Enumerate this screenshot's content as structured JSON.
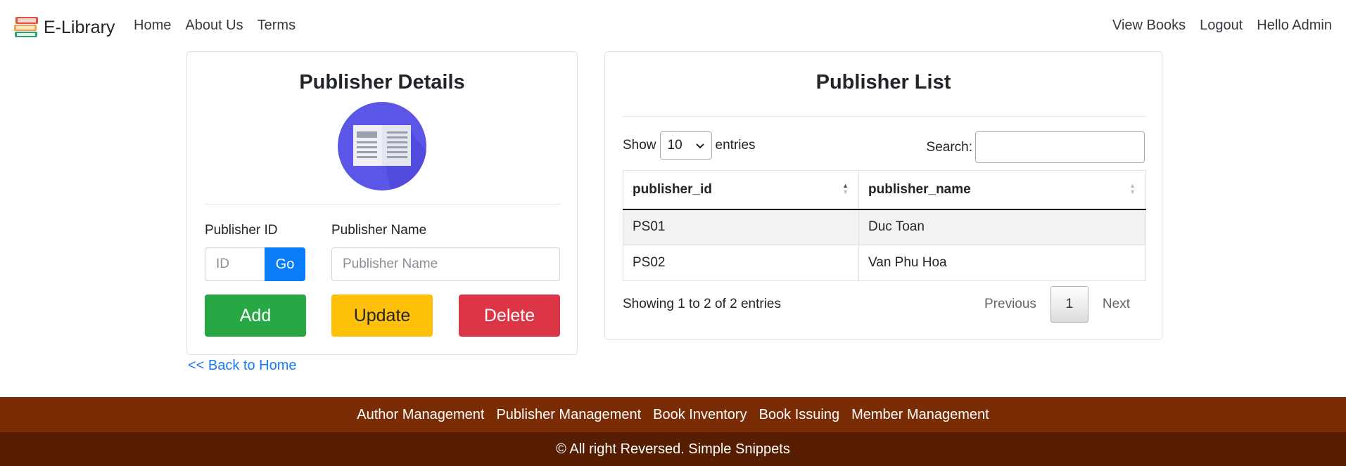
{
  "navbar": {
    "brand": "E-Library",
    "left_links": [
      "Home",
      "About Us",
      "Terms"
    ],
    "right_links": [
      "View Books",
      "Logout",
      "Hello Admin"
    ]
  },
  "details_card": {
    "title": "Publisher Details",
    "publisher_id_label": "Publisher ID",
    "publisher_id_placeholder": "ID",
    "go_label": "Go",
    "publisher_name_label": "Publisher Name",
    "publisher_name_placeholder": "Publisher Name",
    "add_label": "Add",
    "update_label": "Update",
    "delete_label": "Delete"
  },
  "back_link": "<< Back to Home",
  "list_card": {
    "title": "Publisher List",
    "show_label": "Show",
    "entries_selected": "10",
    "entries_label": "entries",
    "search_label": "Search:",
    "columns": [
      "publisher_id",
      "publisher_name"
    ],
    "rows": [
      [
        "PS01",
        "Duc Toan"
      ],
      [
        "PS02",
        "Van Phu Hoa"
      ]
    ],
    "info": "Showing 1 to 2 of 2 entries",
    "pagination": {
      "previous": "Previous",
      "current_page": "1",
      "next": "Next"
    }
  },
  "footer": {
    "links": [
      "Author Management",
      "Publisher Management",
      "Book Inventory",
      "Book Issuing",
      "Member Management"
    ],
    "copyright": "© All right Reversed. Simple Snippets"
  },
  "colors": {
    "primary": "#0b7cf7",
    "success": "#28a745",
    "warning": "#ffc107",
    "danger": "#dc3545",
    "footer_top": "#7a2d05",
    "footer_bottom": "#561d01",
    "logo_circle": "#5b55e8"
  }
}
